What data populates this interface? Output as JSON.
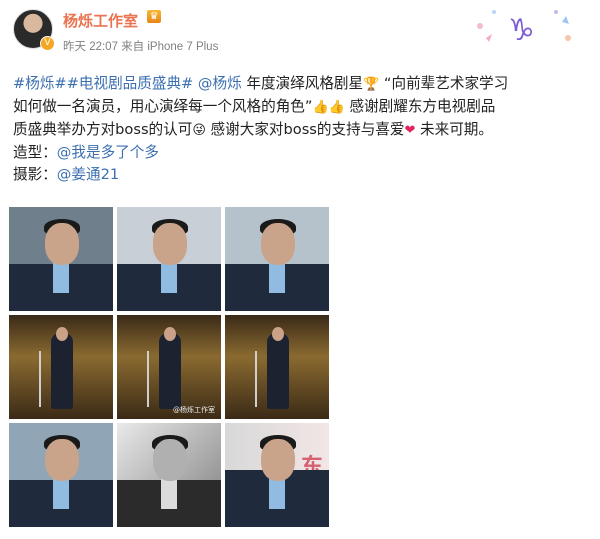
{
  "header": {
    "name": "杨烁工作室",
    "meta": "昨天 22:07 来自 iPhone 7 Plus",
    "avatar_icon": "avatar-icon",
    "verified_icon": "verified-badge-icon",
    "member_icon": "crown-icon",
    "corner_icon": "capricorn-icon"
  },
  "post": {
    "line1": {
      "tag1": "#杨烁#",
      "tag2": "#电视剧品质盛典#",
      "mention": "@杨烁",
      "text": " 年度演绎风格剧星",
      "trophy": "🏆",
      "quote": " “向前辈艺术家学习"
    },
    "line2": {
      "text": "如何做一名演员，用心演绎每一个风格的角色”",
      "emoji": "👍👍",
      "text2": " 感谢剧耀东方电视剧品"
    },
    "line3": {
      "text": "质盛典举办方对boss的认可",
      "emoji1": "😜",
      "text2": " 感谢大家对boss的支持与喜爱",
      "emoji2": "❤",
      "text3": " 未来可期。"
    },
    "line4": {
      "label": "造型：",
      "mention": "@我是多了个多"
    },
    "line5": {
      "label": "摄影：",
      "mention": "@姜通21"
    }
  },
  "photos": {
    "watermark": "@杨烁工作室",
    "bg_text": "东"
  },
  "colors": {
    "name": "#eb7350",
    "link": "#3b6fb0",
    "meta": "#808080"
  }
}
